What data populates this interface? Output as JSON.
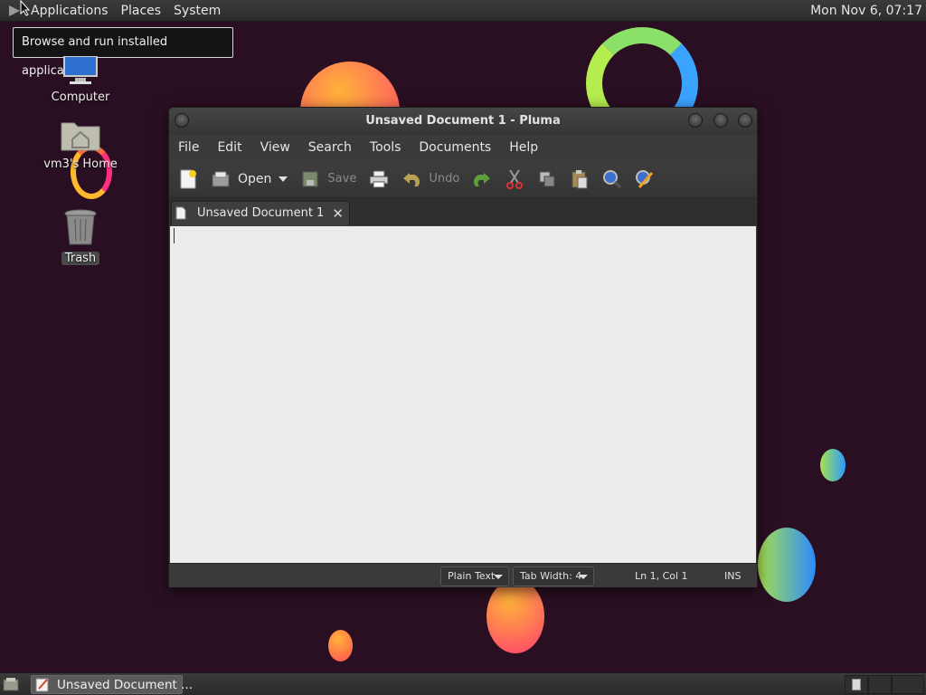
{
  "top_panel": {
    "menus": [
      "Applications",
      "Places",
      "System"
    ],
    "clock": "Mon Nov  6, 07:17"
  },
  "tooltip": "Browse and run installed applications",
  "desktop_icons": {
    "computer": "Computer",
    "home": "vm3's Home",
    "trash": "Trash"
  },
  "window": {
    "title": "Unsaved Document 1 - Pluma",
    "menus": [
      "File",
      "Edit",
      "View",
      "Search",
      "Tools",
      "Documents",
      "Help"
    ],
    "toolbar": {
      "open_label": "Open",
      "save_label": "Save",
      "undo_label": "Undo"
    },
    "tab_label": "Unsaved Document 1",
    "tab_close": "✕",
    "status": {
      "language": "Plain Text",
      "tab_width": "Tab Width:  4",
      "position": "Ln 1, Col 1",
      "mode": "INS"
    }
  },
  "taskbar": {
    "task_label": "Unsaved Document ..."
  },
  "colors": {
    "desktop_bg": "#2a0f22",
    "editor_bg": "#ececec",
    "panel_bg": "#333333"
  }
}
